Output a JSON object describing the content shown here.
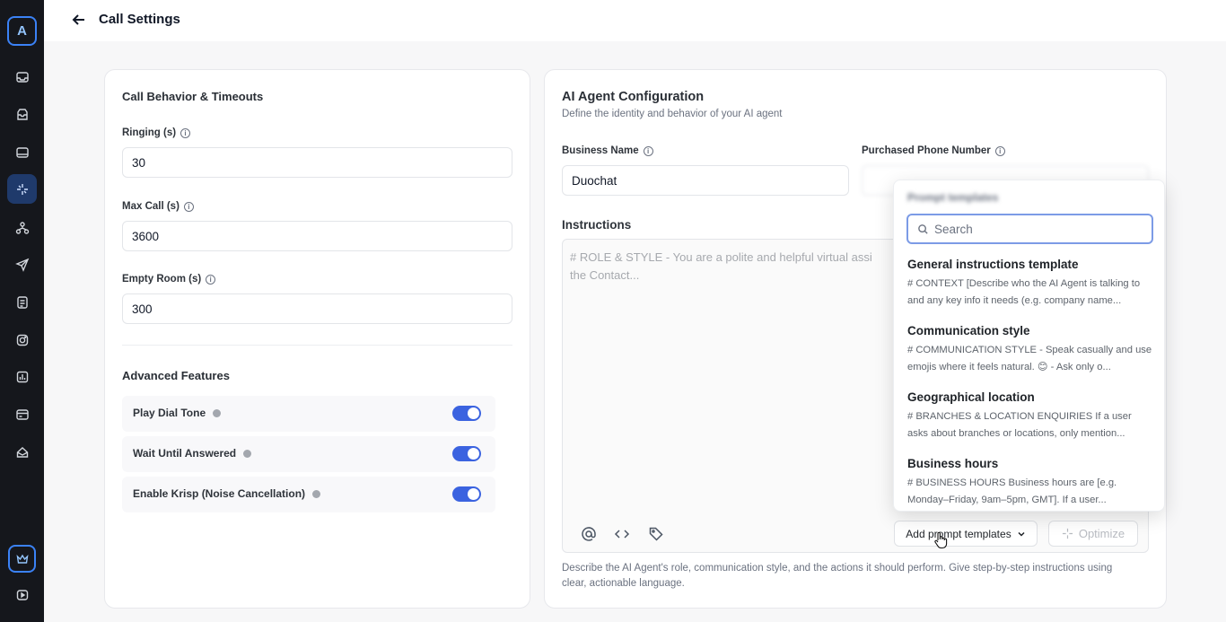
{
  "sidebar": {
    "logo_letter": "A",
    "items": [
      {
        "icon": "inbox-icon"
      },
      {
        "icon": "archive-icon"
      },
      {
        "icon": "database-icon"
      },
      {
        "icon": "ai-sparkle-icon"
      },
      {
        "icon": "hierarchy-icon"
      },
      {
        "icon": "send-icon"
      },
      {
        "icon": "document-icon"
      },
      {
        "icon": "instagram-icon"
      },
      {
        "icon": "chart-icon"
      },
      {
        "icon": "card-icon"
      },
      {
        "icon": "mailbox-icon"
      }
    ],
    "bottom_items": [
      {
        "icon": "crown-icon"
      },
      {
        "icon": "video-icon"
      }
    ],
    "accent_color": "#3b82f6"
  },
  "header": {
    "title": "Call Settings"
  },
  "call_behavior": {
    "title": "Call Behavior & Timeouts",
    "fields": [
      {
        "label": "Ringing (s)",
        "value": "30"
      },
      {
        "label": "Max Call (s)",
        "value": "3600"
      },
      {
        "label": "Empty Room (s)",
        "value": "300"
      }
    ]
  },
  "advanced": {
    "title": "Advanced Features",
    "toggles": [
      {
        "label": "Play Dial Tone",
        "on": true
      },
      {
        "label": "Wait Until Answered",
        "on": true
      },
      {
        "label": "Enable Krisp (Noise Cancellation)",
        "on": true
      }
    ],
    "toggle_color": "#3b63e0"
  },
  "agent_config": {
    "title": "AI Agent Configuration",
    "subtitle": "Define the identity and behavior of your AI agent",
    "business_name_label": "Business Name",
    "business_name_value": "Duochat",
    "phone_label": "Purchased Phone Number",
    "instructions_label": "Instructions",
    "instructions_placeholder": "# ROLE & STYLE - You are a polite and helpful virtual assi\nthe Contact...",
    "add_templates_label": "Add prompt templates",
    "optimize_label": "Optimize",
    "help_text": "Describe the AI Agent's role, communication style, and the actions it should perform. Give step-by-step instructions using clear, actionable language."
  },
  "templates_dropdown": {
    "title": "Prompt templates",
    "search_placeholder": "Search",
    "items": [
      {
        "title": "General instructions template",
        "desc": "# CONTEXT [Describe who the AI Agent is talking to and any key info it needs (e.g. company name..."
      },
      {
        "title": "Communication style",
        "desc": "# COMMUNICATION STYLE - Speak casually and use emojis where it feels natural. 😊 - Ask only o..."
      },
      {
        "title": "Geographical location",
        "desc": "# BRANCHES & LOCATION ENQUIRIES If a user asks about branches or locations, only mention..."
      },
      {
        "title": "Business hours",
        "desc": "# BUSINESS HOURS Business hours are [e.g. Monday–Friday, 9am–5pm, GMT]. If a user..."
      }
    ]
  }
}
